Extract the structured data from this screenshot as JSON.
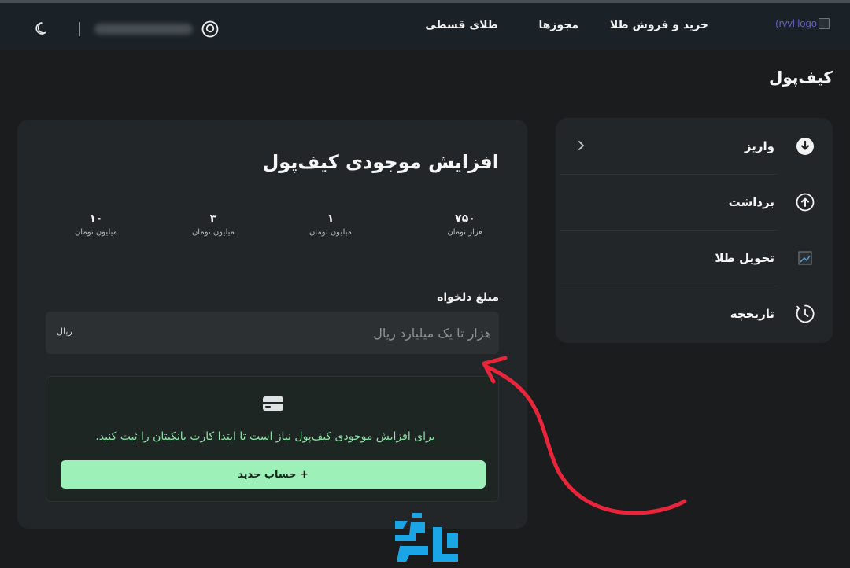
{
  "header": {
    "logo_alt": "(rvvl logo",
    "nav": [
      "خرید و فروش طلا",
      "مجوزها",
      "طلای قسطی"
    ],
    "theme_icon": "moon-icon",
    "user_icon": "user-circle-icon"
  },
  "page_title": "کیف‌پول",
  "sidebar": {
    "items": [
      {
        "label": "واریز",
        "icon": "download-circle-icon"
      },
      {
        "label": "برداشت",
        "icon": "upload-circle-icon"
      },
      {
        "label": "تحویل طلا",
        "icon": "broken-image-icon"
      },
      {
        "label": "تاریخچه",
        "icon": "history-clock-icon"
      }
    ]
  },
  "deposit": {
    "title": "افزایش موجودی کیف‌پول",
    "presets": [
      {
        "value": "۷۵۰",
        "unit": "هزار تومان"
      },
      {
        "value": "۱",
        "unit": "میلیون تومان"
      },
      {
        "value": "۳",
        "unit": "میلیون تومان"
      },
      {
        "value": "۱۰",
        "unit": "میلیون تومان"
      }
    ],
    "amount_label": "مبلغ دلخواه",
    "amount_placeholder": "هزار تا یک میلیارد ریال",
    "amount_value": "",
    "amount_suffix": "ریال",
    "notice_text": "برای افزایش موجودی کیف‌پول نیاز است تا ابتدا کارت بانکیتان را ثبت کنید.",
    "new_account_button": "+ حساب جدید"
  },
  "colors": {
    "background": "#1a1c1d",
    "panel": "#232628",
    "accent_green": "#9ef0b9",
    "notice_text": "#8fe0a8",
    "annotation_red": "#e8253a",
    "watermark_blue": "#1aa6e6"
  }
}
